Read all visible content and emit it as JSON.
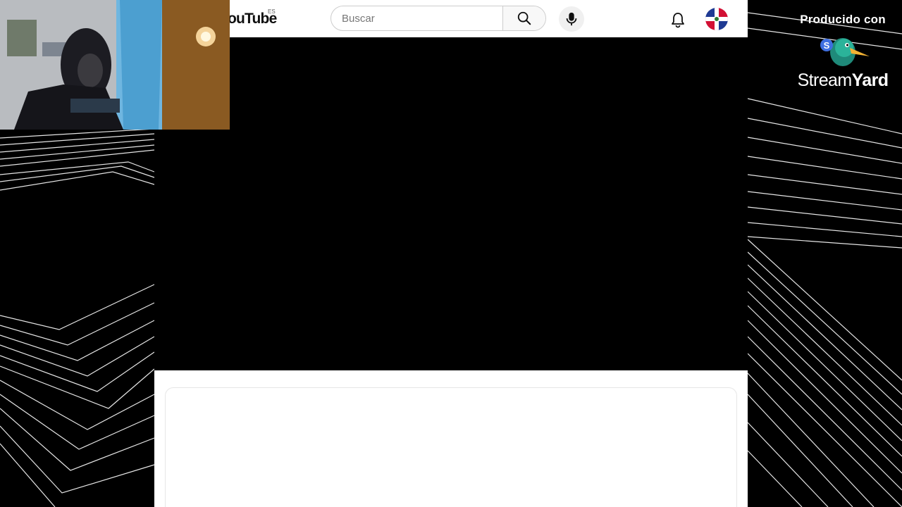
{
  "youtube": {
    "logo_text": "ouTube",
    "region_code": "ES",
    "search": {
      "placeholder": "Buscar",
      "value": ""
    },
    "icons": {
      "search": "search-icon",
      "mic": "microphone-icon",
      "notifications": "bell-icon",
      "avatar": "dominican-flag-avatar"
    }
  },
  "streamyard": {
    "caption": "Producido con",
    "brand_name_part1": "Stream",
    "brand_name_part2": "Yard"
  },
  "colors": {
    "background": "#000000",
    "lines": "#ffffff",
    "flag_blue": "#1f3a93",
    "flag_red": "#d21034",
    "duck_green": "#1f8a7a",
    "duck_beak": "#f2b233"
  }
}
